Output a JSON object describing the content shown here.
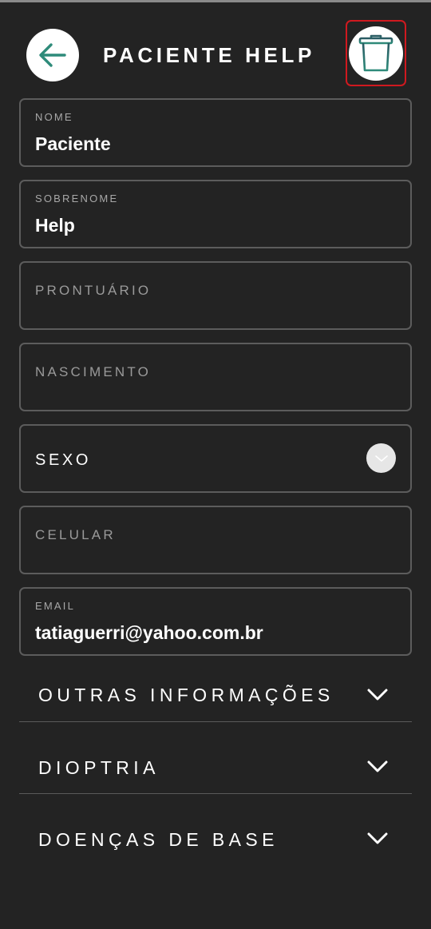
{
  "header": {
    "title": "PACIENTE HELP",
    "back_icon": "arrow-left-icon",
    "delete_icon": "trash-icon",
    "accent_color": "#2e8b7a",
    "highlight_color": "#d0191f"
  },
  "form": {
    "nome": {
      "label": "NOME",
      "value": "Paciente"
    },
    "sobrenome": {
      "label": "SOBRENOME",
      "value": "Help"
    },
    "prontuario": {
      "label": "PRONTUÁRIO",
      "value": ""
    },
    "nascimento": {
      "label": "NASCIMENTO",
      "value": ""
    },
    "sexo": {
      "label": "SEXO",
      "icon": "chevron-down-icon"
    },
    "celular": {
      "label": "CELULAR",
      "value": ""
    },
    "email": {
      "label": "EMAIL",
      "value": "tatiaguerri@yahoo.com.br"
    }
  },
  "sections": {
    "outras": {
      "label": "OUTRAS INFORMAÇÕES",
      "icon": "chevron-down-icon"
    },
    "dioptria": {
      "label": "DIOPTRIA",
      "icon": "chevron-down-icon"
    },
    "doencas": {
      "label": "DOENÇAS DE BASE",
      "icon": "chevron-down-icon"
    }
  }
}
